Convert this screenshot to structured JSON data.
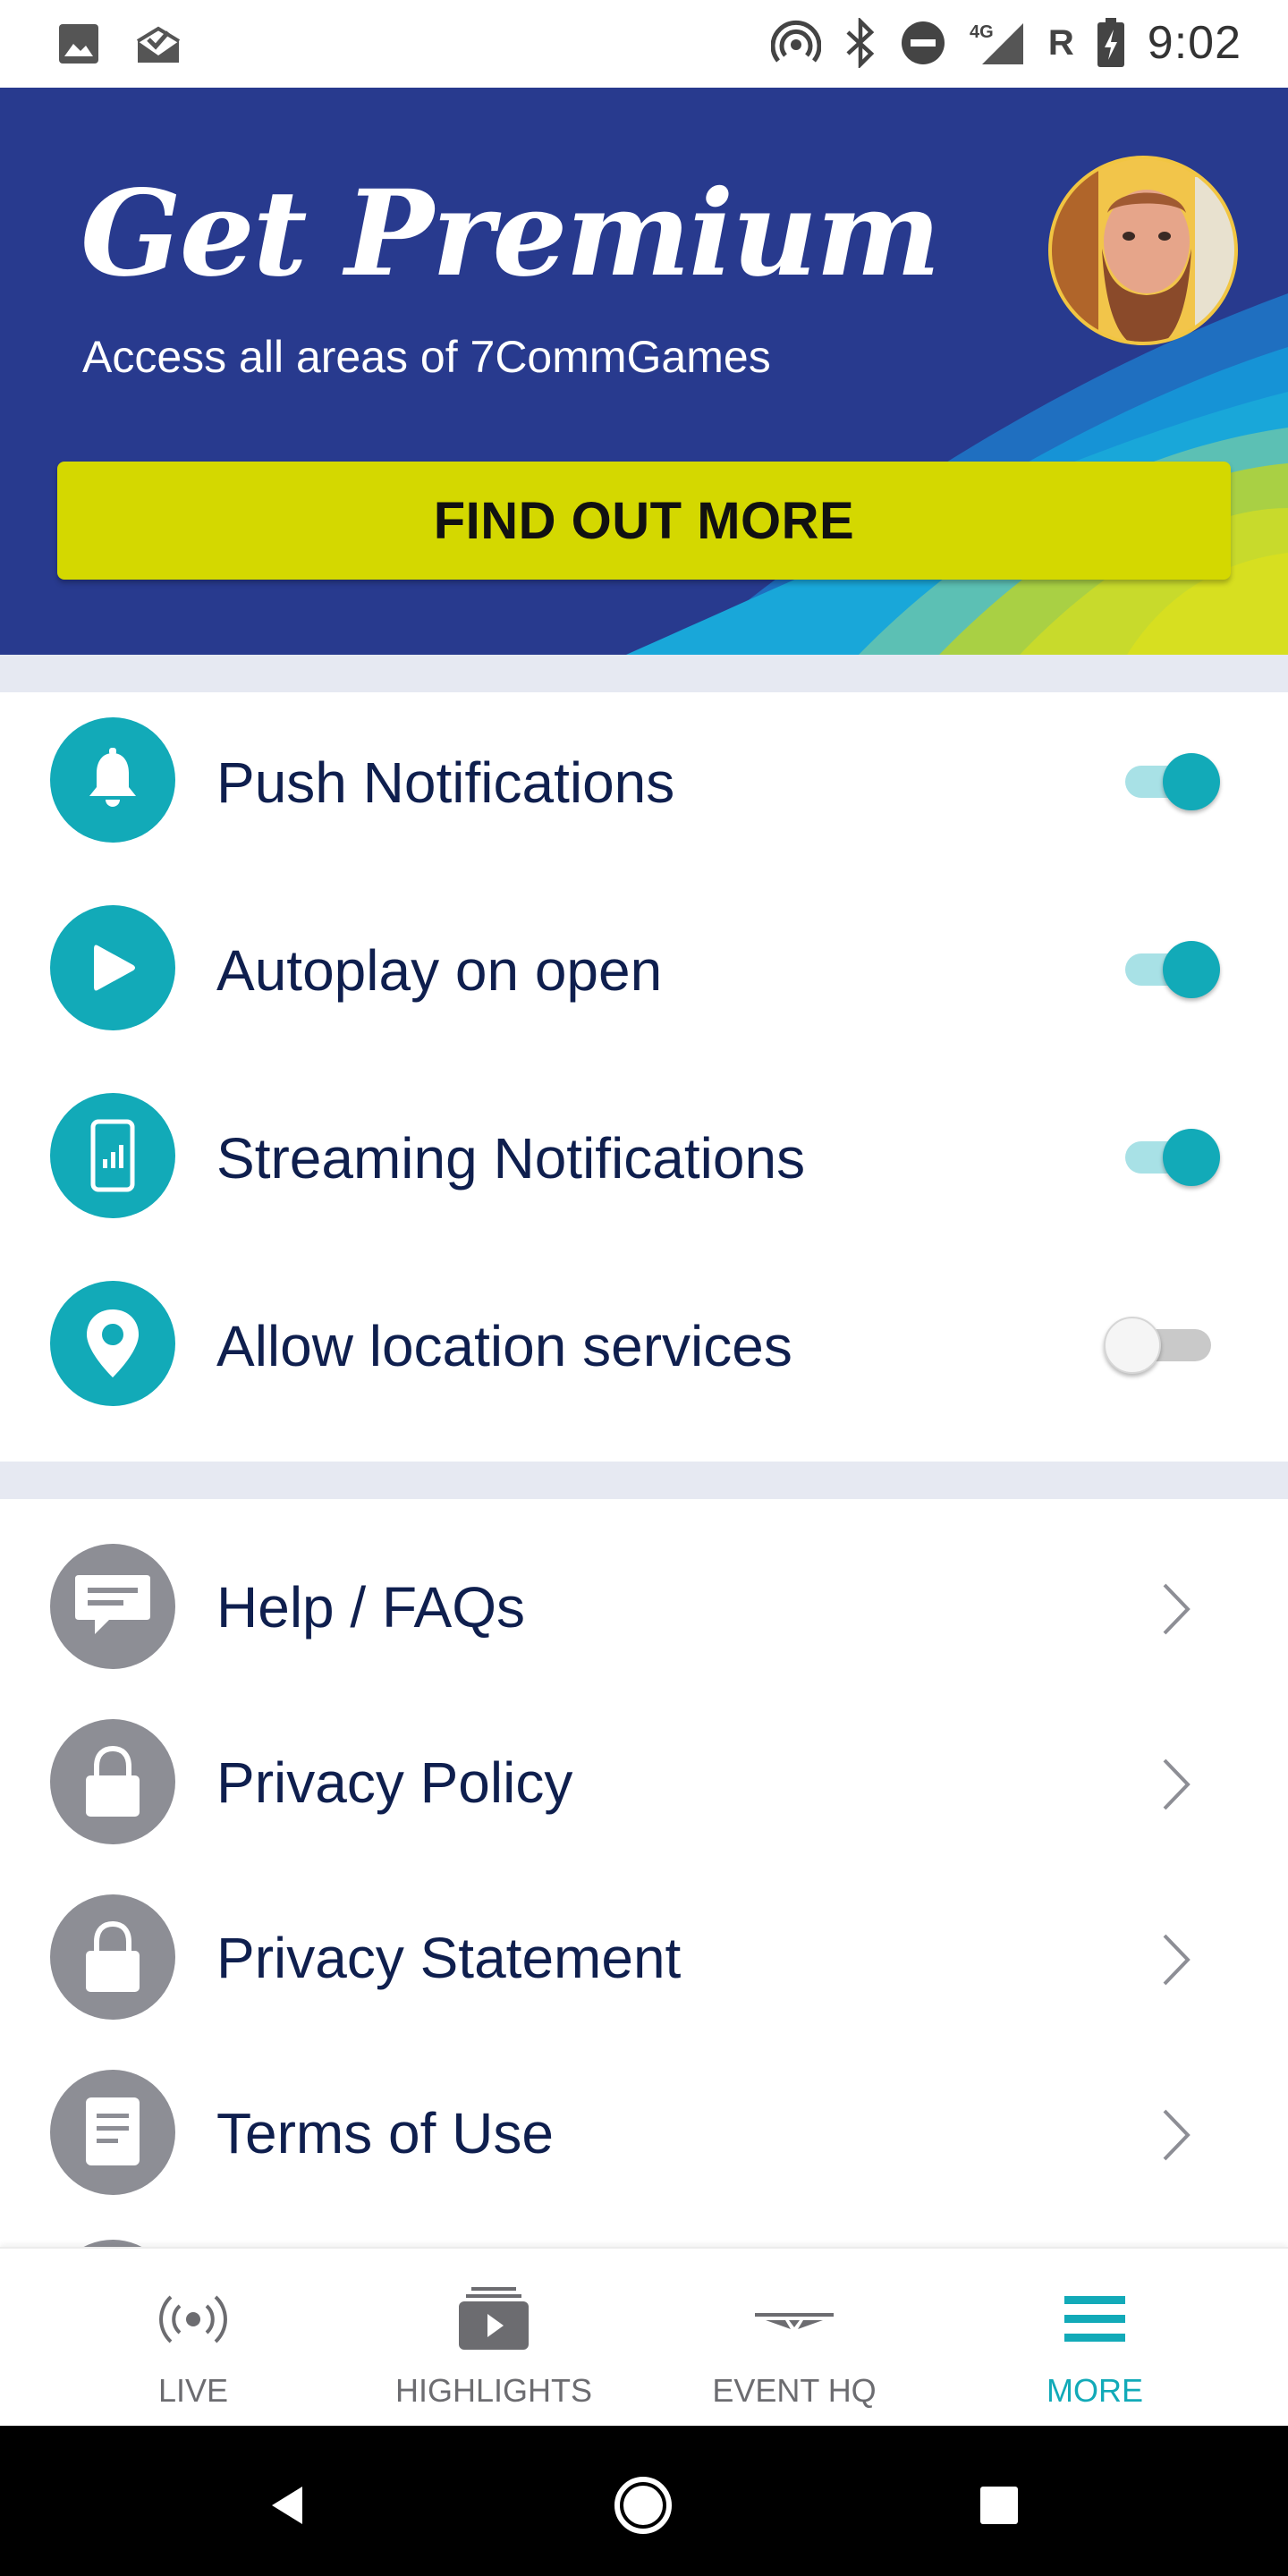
{
  "status_bar": {
    "time": "9:02",
    "left_icons": [
      "image-icon",
      "mail-check-icon"
    ],
    "right_icons": [
      "hotspot-icon",
      "bluetooth-icon",
      "do-not-disturb-icon",
      "signal-4g-icon",
      "roaming-icon",
      "battery-charging-icon"
    ],
    "network_label": "4G",
    "roaming_label": "R"
  },
  "banner": {
    "title": "Get Premium",
    "subtitle": "Access all areas of 7CommGames",
    "cta_label": "FIND OUT MORE",
    "colors": {
      "background": "#283a8e",
      "cta": "#d4d800"
    }
  },
  "settings": {
    "toggles": [
      {
        "label": "Push Notifications",
        "icon": "bell-icon",
        "on": true
      },
      {
        "label": "Autoplay on open",
        "icon": "play-icon",
        "on": true
      },
      {
        "label": "Streaming Notifications",
        "icon": "phone-signal-icon",
        "on": true
      },
      {
        "label": "Allow location services",
        "icon": "location-pin-icon",
        "on": false
      }
    ],
    "links": [
      {
        "label": "Help / FAQs",
        "icon": "chat-bubble-icon"
      },
      {
        "label": "Privacy Policy",
        "icon": "lock-icon"
      },
      {
        "label": "Privacy Statement",
        "icon": "lock-icon"
      },
      {
        "label": "Terms of Use",
        "icon": "document-icon"
      }
    ]
  },
  "bottom_nav": {
    "items": [
      {
        "label": "LIVE",
        "icon": "broadcast-icon",
        "active": false
      },
      {
        "label": "HIGHLIGHTS",
        "icon": "video-stack-icon",
        "active": false
      },
      {
        "label": "EVENT HQ",
        "icon": "event-logo-icon",
        "active": false
      },
      {
        "label": "MORE",
        "icon": "menu-icon",
        "active": true
      }
    ]
  },
  "colors": {
    "accent": "#12aab8",
    "text_primary": "#0f1f4e",
    "inactive_icon": "#8d8e95"
  }
}
